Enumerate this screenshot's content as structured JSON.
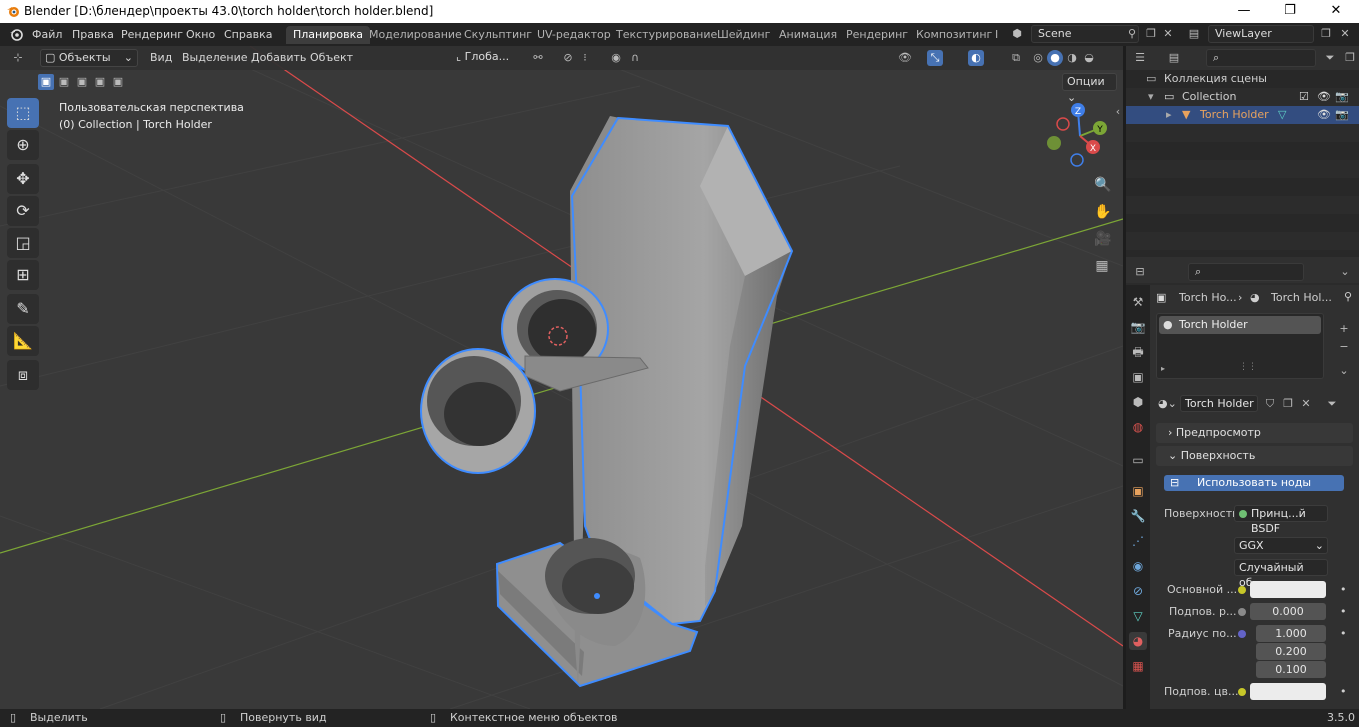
{
  "window": {
    "title": "Blender [D:\\блендер\\проекты 43.0\\torch holder\\torch holder.blend]",
    "minimize": "—",
    "maximize": "❐",
    "close": "✕"
  },
  "menu": [
    "Файл",
    "Правка",
    "Рендеринг",
    "Окно",
    "Справка"
  ],
  "workspaces": [
    "Планировка",
    "Моделирование",
    "Скульптинг",
    "UV-редактор",
    "Текстурирование",
    "Шейдинг",
    "Анимация",
    "Рендеринг",
    "Композитинг"
  ],
  "workspace_separator": "I",
  "scene": {
    "name": "Scene",
    "view_layer": "ViewLayer"
  },
  "viewport_header": {
    "mode": "Объекты",
    "menus": [
      "Вид",
      "Выделение",
      "Добавить",
      "Объект"
    ],
    "orientation": "Глоба...",
    "options": "Опции"
  },
  "viewport_info": {
    "line1": "Пользовательская перспектива",
    "line2": "(0) Collection | Torch Holder"
  },
  "gizmo": {
    "x": "X",
    "y": "Y",
    "z": "Z"
  },
  "tools": [
    "select-box",
    "cursor",
    "move",
    "rotate",
    "scale",
    "transform",
    "annotate",
    "measure",
    "add-cube"
  ],
  "outliner": {
    "scene_collection": "Коллекция сцены",
    "collection": "Collection",
    "object": "Torch Holder"
  },
  "properties": {
    "breadcrumb_object": "Torch Ho...",
    "breadcrumb_material": "Torch Hol...",
    "slot": "Torch Holder",
    "material_name": "Torch Holder",
    "panel_preview": "Предпросмотр",
    "panel_surface": "Поверхность",
    "use_nodes": "Использовать ноды",
    "surface_label": "Поверхность",
    "surface_value": "Принц...й BSDF",
    "distribution": "GGX",
    "subsurface_method": "Случайный об...",
    "base_color_label": "Основной ...",
    "subsurface_label": "Подпов. р...",
    "subsurface_value": "0.000",
    "radius_label": "Радиус по...",
    "radius_values": [
      "1.000",
      "0.200",
      "0.100"
    ],
    "subsurface_color_label": "Подпов. цв..."
  },
  "status": {
    "select": "Выделить",
    "rotate": "Повернуть вид",
    "context": "Контекстное меню объектов",
    "version": "3.5.0"
  },
  "colors": {
    "accent": "#4772b3",
    "selection_outline": "#3f8cff",
    "x_axis": "#d94a4a",
    "y_axis": "#7ca636",
    "active_object": "#e8a25e"
  }
}
